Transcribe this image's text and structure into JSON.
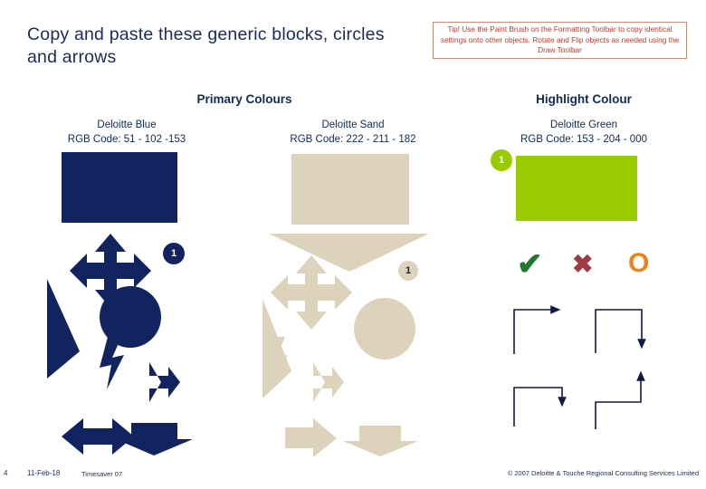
{
  "slide": {
    "title": "Copy and paste these generic blocks, circles and arrows",
    "tip": "Tip! Use the Paint Brush on the Formatting Toolbar to copy identical settings onto other objects. Rotate and Flip objects as needed using the Draw Toolbar"
  },
  "sections": {
    "primary": {
      "heading": "Primary Colours",
      "colors": [
        {
          "name": "Deloitte Blue",
          "rgb_label": "RGB Code: 51 - 102 -153",
          "hex": "#122460",
          "badge": "1"
        },
        {
          "name": "Deloitte Sand",
          "rgb_label": "RGB Code: 222 - 211 - 182",
          "hex": "#ddd2bb",
          "badge": "1"
        }
      ]
    },
    "highlight": {
      "heading": "Highlight Colour",
      "colors": [
        {
          "name": "Deloitte Green",
          "rgb_label": "RGB Code: 153 - 204 - 000",
          "hex": "#99cc00",
          "badge": "1"
        }
      ]
    }
  },
  "symbols": [
    {
      "name": "tick-mark",
      "glyph": "✔",
      "color": "#1d7a2f"
    },
    {
      "name": "cross-mark",
      "glyph": "✖",
      "color": "#a03a45"
    },
    {
      "name": "circle-mark",
      "glyph": "O",
      "color": "#e8851a"
    }
  ],
  "connectors": [
    {
      "name": "elbow-up-right",
      "direction": "right"
    },
    {
      "name": "elbow-right-down",
      "direction": "down"
    },
    {
      "name": "elbow-right-down-2",
      "direction": "down"
    },
    {
      "name": "elbow-right-up",
      "direction": "up"
    }
  ],
  "footer": {
    "page_number": "4",
    "date": "11-Feb-18",
    "deck_name": "Timesaver 07",
    "copyright": "© 2007 Deloitte & Touche Regional Consulting Services Limited"
  }
}
